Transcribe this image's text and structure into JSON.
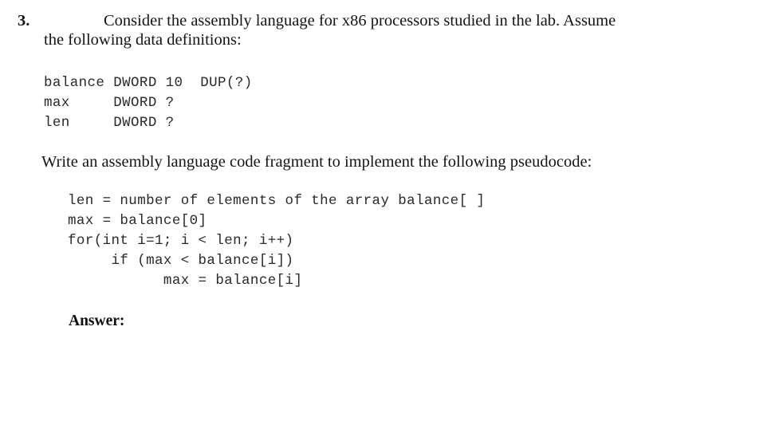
{
  "question": {
    "number": "3.",
    "stem_line_1": "Consider the assembly language for x86 processors studied in the lab. Assume",
    "stem_line_2": "the following data definitions:"
  },
  "data_definitions": {
    "lines": [
      "balance DWORD 10  DUP(?)",
      "max     DWORD ?",
      "len     DWORD ?"
    ],
    "text": "balance DWORD 10  DUP(?)\nmax     DWORD ?\nlen     DWORD ?"
  },
  "prompt": {
    "text": "Write an assembly language code fragment to implement the following pseudocode:"
  },
  "pseudocode": {
    "lines": [
      "len = number of elements of the array balance[ ]",
      "max = balance[0]",
      "for(int i=1; i < len; i++)",
      "     if (max < balance[i])",
      "           max = balance[i]"
    ],
    "text": "len = number of elements of the array balance[ ]\nmax = balance[0]\nfor(int i=1; i < len; i++)\n     if (max < balance[i])\n           max = balance[i]"
  },
  "answer": {
    "label": "Answer:"
  }
}
